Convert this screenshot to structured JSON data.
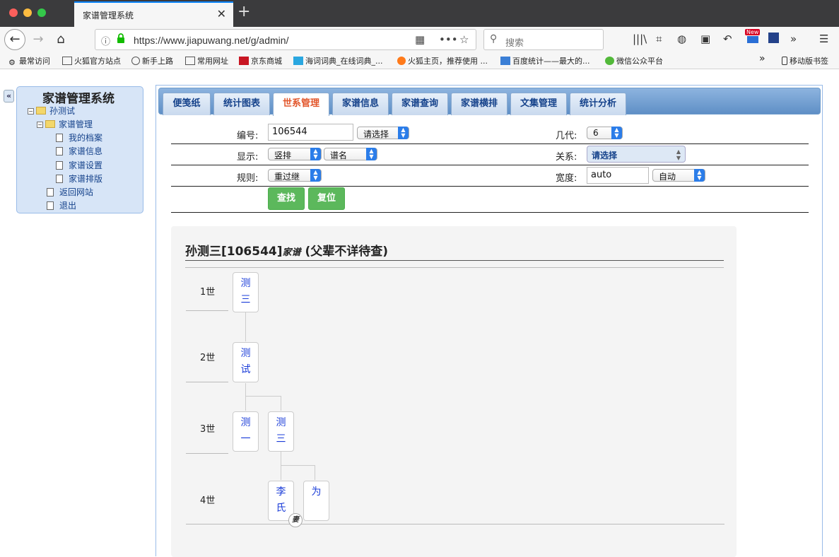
{
  "browser": {
    "tab_title": "家谱管理系统",
    "url": "https://www.jiapuwang.net/g/admin/",
    "search_placeholder": "搜索",
    "bookmarks": [
      "最常访问",
      "火狐官方站点",
      "新手上路",
      "常用网址",
      "京东商城",
      "海词词典_在线词典_...",
      "火狐主页，推荐使用 ...",
      "百度统计——最大的...",
      "微信公众平台",
      "移动版书签"
    ],
    "new_badge": "New"
  },
  "sidebar": {
    "title": "家谱管理系统",
    "root": "孙测试",
    "group": "家谱管理",
    "items": [
      "我的档案",
      "家谱信息",
      "家谱设置",
      "家谱排版"
    ],
    "links": [
      "返回网站",
      "退出"
    ],
    "collapse_label": "«"
  },
  "tabs": [
    "便笺纸",
    "统计图表",
    "世系管理",
    "家谱信息",
    "家谱查询",
    "家谱横排",
    "文集管理",
    "统计分析"
  ],
  "active_tab": "世系管理",
  "form": {
    "id_label": "编号:",
    "id_value": "106544",
    "id_select": "请选择",
    "gen_label": "几代:",
    "gen_value": "6",
    "display_label": "显示:",
    "display_value": "竖排",
    "display_name": "谱名",
    "relation_label": "关系:",
    "relation_value": "请选择",
    "rule_label": "规则:",
    "rule_value": "重过继",
    "width_label": "宽度:",
    "width_value": "auto",
    "width_select": "自动",
    "search_btn": "查找",
    "reset_btn": "复位"
  },
  "tree": {
    "title_main": "孙测三[106544]",
    "title_small": "家谱",
    "title_note": " (父辈不详待查)",
    "generations": [
      "1世",
      "2世",
      "3世",
      "4世"
    ],
    "persons": {
      "p1": "测三",
      "p2": "测试",
      "p3a": "测一",
      "p3b": "测三",
      "p4a": "李氏",
      "p4b": "为"
    },
    "wife_badge": "妻"
  }
}
